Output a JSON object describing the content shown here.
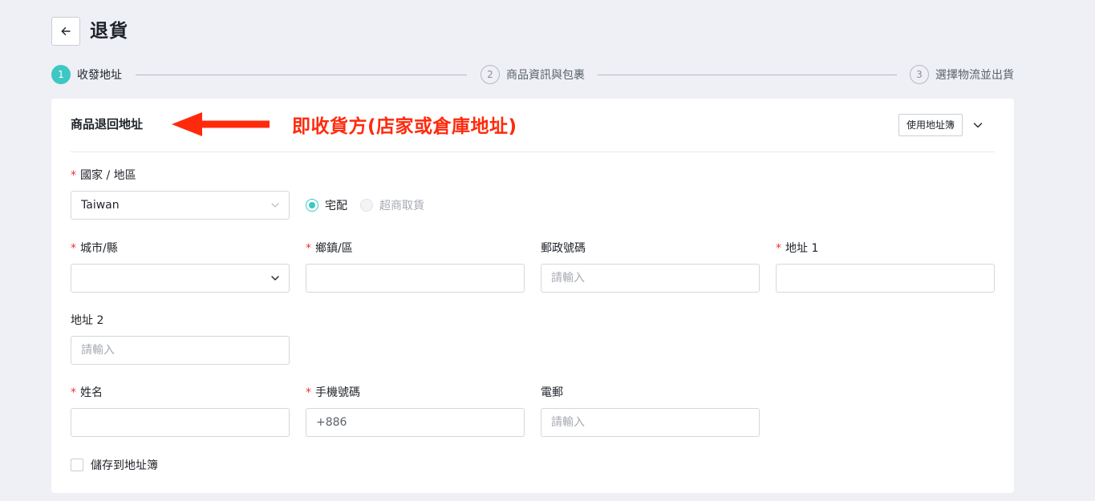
{
  "header": {
    "back_icon": "arrow-left-icon",
    "title": "退貨"
  },
  "steps": [
    {
      "number": "1",
      "label": "收發地址",
      "active": true
    },
    {
      "number": "2",
      "label": "商品資訊與包裹",
      "active": false
    },
    {
      "number": "3",
      "label": "選擇物流並出貨",
      "active": false
    }
  ],
  "card": {
    "title": "商品退回地址",
    "annotation": "即收貨方(店家或倉庫地址)",
    "address_book_button": "使用地址簿",
    "collapse_icon": "chevron-down-icon"
  },
  "form": {
    "required_mark": "*",
    "country": {
      "label": "國家 / 地區",
      "value": "Taiwan"
    },
    "delivery": [
      {
        "label": "宅配",
        "checked": true,
        "disabled": false
      },
      {
        "label": "超商取貨",
        "checked": false,
        "disabled": true
      }
    ],
    "city": {
      "label": "城市/縣",
      "value": ""
    },
    "district": {
      "label": "鄉鎮/區",
      "value": ""
    },
    "postal": {
      "label": "郵政號碼",
      "placeholder": "請輸入"
    },
    "address1": {
      "label": "地址 1",
      "value": ""
    },
    "address2": {
      "label": "地址 2",
      "placeholder": "請輸入"
    },
    "name": {
      "label": "姓名",
      "value": ""
    },
    "phone": {
      "label": "手機號碼",
      "value": "+886"
    },
    "email": {
      "label": "電郵",
      "placeholder": "請輸入"
    },
    "save_checkbox": {
      "label": "儲存到地址簿",
      "checked": false
    }
  },
  "colors": {
    "accent": "#3ec7c4",
    "required": "#f0322d",
    "annotation": "#ff2a0c",
    "background": "#eef0f5"
  }
}
